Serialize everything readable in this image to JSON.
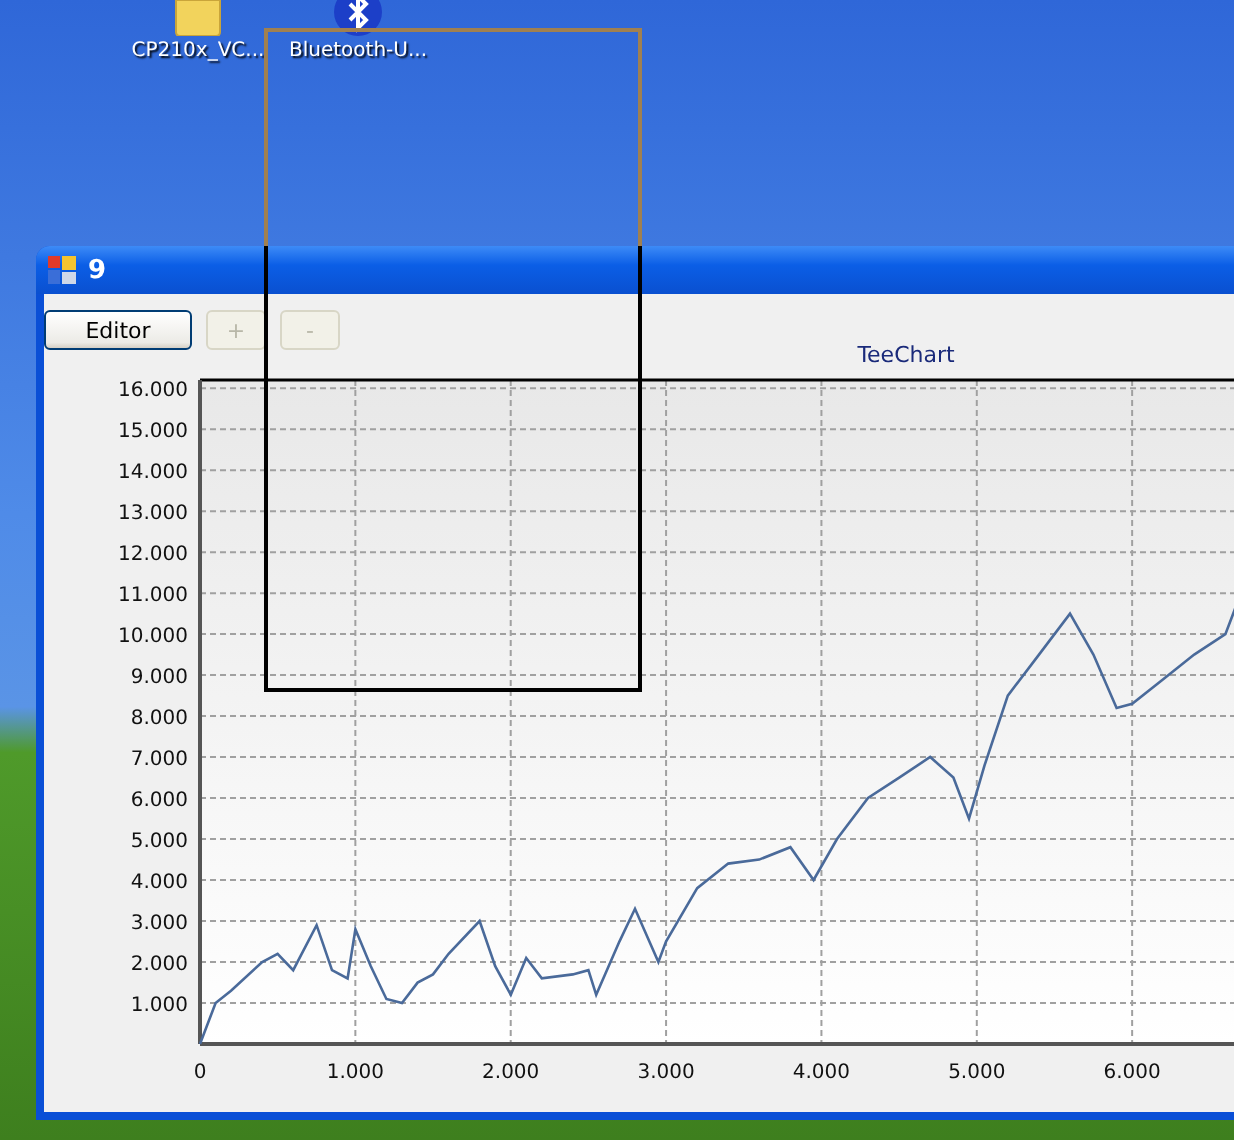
{
  "desktop": {
    "icons": [
      {
        "kind": "folder",
        "label": "CP210x_VC..."
      },
      {
        "kind": "bluetooth",
        "label": "Bluetooth-U..."
      }
    ]
  },
  "window": {
    "title": "9"
  },
  "toolbar": {
    "buttons": [
      {
        "label": "Editor",
        "disabled": false
      },
      {
        "label": "+",
        "disabled": true
      },
      {
        "label": "-",
        "disabled": true
      }
    ]
  },
  "chart": {
    "chart_data": {
      "type": "line",
      "title": "TeeChart",
      "x": [
        0,
        100,
        200,
        400,
        500,
        600,
        750,
        850,
        950,
        1000,
        1100,
        1200,
        1300,
        1400,
        1500,
        1600,
        1800,
        1900,
        2000,
        2100,
        2200,
        2400,
        2500,
        2550,
        2700,
        2800,
        2950,
        3000,
        3200,
        3400,
        3600,
        3800,
        3950,
        4100,
        4300,
        4500,
        4700,
        4850,
        4950,
        5050,
        5200,
        5400,
        5600,
        5750,
        5900,
        6000,
        6200,
        6400,
        6600,
        6720
      ],
      "grid": true,
      "series": [
        {
          "color": "#4a6a9a",
          "values": [
            0,
            1000,
            1300,
            2000,
            2200,
            1800,
            2900,
            1800,
            1600,
            2800,
            1900,
            1100,
            1000,
            1500,
            1700,
            2200,
            3000,
            1900,
            1200,
            2100,
            1600,
            1700,
            1800,
            1200,
            2500,
            3300,
            2000,
            2500,
            3800,
            4400,
            4500,
            4800,
            4000,
            5000,
            6000,
            6500,
            7000,
            6500,
            5500,
            6800,
            8500,
            9500,
            10500,
            9500,
            8200,
            8300,
            8900,
            9500,
            10000,
            11200
          ]
        }
      ],
      "xlim": [
        0,
        6720
      ],
      "ylim": [
        0,
        16200
      ],
      "xticks": [
        {
          "value": 0,
          "label": "0"
        },
        {
          "value": 1000,
          "label": "1.000"
        },
        {
          "value": 2000,
          "label": "2.000"
        },
        {
          "value": 3000,
          "label": "3.000"
        },
        {
          "value": 4000,
          "label": "4.000"
        },
        {
          "value": 5000,
          "label": "5.000"
        },
        {
          "value": 6000,
          "label": "6.000"
        }
      ],
      "yticks": [
        {
          "value": 1000,
          "label": "1.000"
        },
        {
          "value": 2000,
          "label": "2.000"
        },
        {
          "value": 3000,
          "label": "3.000"
        },
        {
          "value": 4000,
          "label": "4.000"
        },
        {
          "value": 5000,
          "label": "5.000"
        },
        {
          "value": 6000,
          "label": "6.000"
        },
        {
          "value": 7000,
          "label": "7.000"
        },
        {
          "value": 8000,
          "label": "8.000"
        },
        {
          "value": 9000,
          "label": "9.000"
        },
        {
          "value": 10000,
          "label": "10.000"
        },
        {
          "value": 11000,
          "label": "11.000"
        },
        {
          "value": 12000,
          "label": "12.000"
        },
        {
          "value": 13000,
          "label": "13.000"
        },
        {
          "value": 14000,
          "label": "14.000"
        },
        {
          "value": 15000,
          "label": "15.000"
        },
        {
          "value": 16000,
          "label": "16.000"
        }
      ]
    }
  }
}
